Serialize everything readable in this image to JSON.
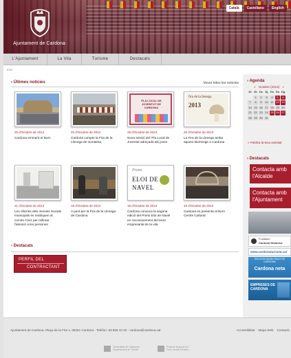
{
  "header": {
    "site_name": "Ajuntament de Cardona",
    "languages": [
      {
        "label": "Català",
        "active": true
      },
      {
        "label": "Castellano",
        "active": false
      },
      {
        "label": "English",
        "active": false
      }
    ]
  },
  "nav": [
    "L'Ajuntament",
    "La Vila",
    "Turisme",
    "Destacats"
  ],
  "breadcrumb": "Inici",
  "news": {
    "title": "Últimes notícies",
    "all_link": "Veure totes les notícies",
    "items": [
      {
        "date": "25 d'Octubre de 2013",
        "text": "Cardona emmerà el Born"
      },
      {
        "date": "25 d'Octubre de 2013",
        "text": "Cardona compte la Fira de la Llenega de montanta"
      },
      {
        "date": "25 d'Octubre de 2013",
        "text": "Nova sessió del 'Pla Local de Joventut adreçada als joves"
      },
      {
        "date": "25 d'Octubre de 2013",
        "text": "La Fira de la Llenega amba aquest diumenge a Cardona"
      },
      {
        "date": "21 d'Octubre de 2013",
        "text": "Les oficines dels Serveis Socials municipals es reubiquen al Centre Cívic per millorar l'atenció a les persones"
      },
      {
        "date": "18 d'Octubre de 2013",
        "text": "A punt per la Fira de la Llenega de Cardona"
      },
      {
        "date": "18 d'Octubre de 2013",
        "text": "Cardona convoca la segona edició del Premi Eloi de Navel en reconeixement del teixit empresarial de la vila"
      },
      {
        "date": "18 d'Octubre de 2013",
        "text": "Cardona es presenta al Born Centre Cultural"
      }
    ]
  },
  "thumbs": {
    "fira_label": "fira de la llenega",
    "fira_year": "2013",
    "pla_label": "PLA LOCAL DE JOVENTUT DE CARDONA",
    "premi_label": "Premi",
    "eloi_label": "ELOI DE",
    "navel_label": "NAVEL"
  },
  "destacats": {
    "title": "Destacats",
    "perfil_line1": "PERFIL DEL",
    "perfil_line2": "CONTRACTANT"
  },
  "sidebar": {
    "agenda_title": "Agenda",
    "cal_month": "Octubre (2013)",
    "cal_prev": "«",
    "cal_next": "»",
    "cal_days": [
      "Dl",
      "Dt",
      "Dc",
      "Dj",
      "Dv",
      "Ds",
      "Dg"
    ],
    "cal_weeks": [
      [
        "",
        "1",
        "2",
        "3",
        "4",
        "5",
        "6"
      ],
      [
        "7",
        "8",
        "9",
        "10",
        "11",
        "12",
        "13"
      ],
      [
        "14",
        "15",
        "16",
        "17",
        "18",
        "19",
        "20"
      ],
      [
        "21",
        "22",
        "23",
        "24",
        "25",
        "26",
        "27"
      ],
      [
        "28",
        "29",
        "30",
        "31",
        "",
        "",
        ""
      ]
    ],
    "cal_events": [
      "5",
      "6",
      "12",
      "13",
      "25",
      "26",
      "27"
    ],
    "publica": "» Publica la teva activitat",
    "destacats_title": "Destacats",
    "contact_alcalde": "Contacta amb l'Alcalde",
    "contact_ajuntament": "Contacta amb l'Ajuntament",
    "fundacio_title": "Fundació",
    "fundacio_sub": "Cardona Històrica",
    "web_link": "www.cardonaturisme.cat",
    "escoles_title": "ESCOLES MUNICIPALS DE CARDONA",
    "cardona_neta": "Cardona neta",
    "empreses_title": "EMPRESES DE CARDONA"
  },
  "footer": {
    "address": "Ajuntament de Cardona. Plaça de la Fira 1, 08261 Cardona · Telèfon: 93 869 10 00 · cardona@cardona.cat",
    "links": [
      "Accessibilitat",
      "Mapa Web",
      "Contacte"
    ],
    "logo1": "Generalitat de Catalunya Departament de Treball",
    "logo2": "Projecte finançat per Fons Social Europeu"
  }
}
